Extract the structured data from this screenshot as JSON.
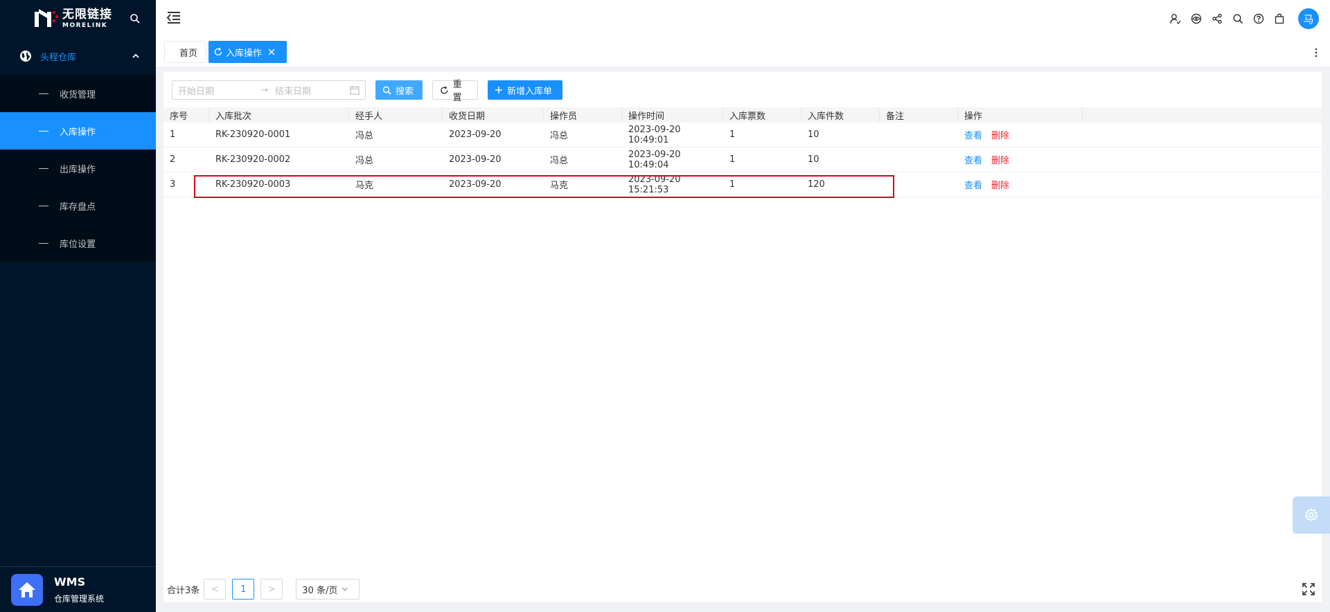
{
  "logo": {
    "cn": "无限链接",
    "en": "MORELINK"
  },
  "sidebar": {
    "group_label": "头程仓库",
    "items": [
      {
        "label": "收货管理",
        "active": false
      },
      {
        "label": "入库操作",
        "active": true
      },
      {
        "label": "出库操作",
        "active": false
      },
      {
        "label": "库存盘点",
        "active": false
      },
      {
        "label": "库位设置",
        "active": false
      }
    ],
    "footer": {
      "title": "WMS",
      "subtitle": "仓库管理系统"
    }
  },
  "header": {
    "avatar_text": "马"
  },
  "tabs": {
    "home": "首页",
    "active": "入库操作"
  },
  "toolbar": {
    "start_placeholder": "开始日期",
    "end_placeholder": "结束日期",
    "range_arrow": "→",
    "search_label": "搜索",
    "reset_label": "重置",
    "add_label": "新增入库单"
  },
  "table": {
    "headers": [
      "序号",
      "入库批次",
      "经手人",
      "收货日期",
      "操作员",
      "操作时间",
      "入库票数",
      "入库件数",
      "备注",
      "操作"
    ],
    "rows": [
      {
        "no": "1",
        "batch": "RK-230920-0001",
        "handler": "冯总",
        "date": "2023-09-20",
        "operator": "冯总",
        "time": "2023-09-20 10:49:01",
        "tickets": "1",
        "pieces": "10",
        "remark": ""
      },
      {
        "no": "2",
        "batch": "RK-230920-0002",
        "handler": "冯总",
        "date": "2023-09-20",
        "operator": "冯总",
        "time": "2023-09-20 10:49:04",
        "tickets": "1",
        "pieces": "10",
        "remark": ""
      },
      {
        "no": "3",
        "batch": "RK-230920-0003",
        "handler": "马克",
        "date": "2023-09-20",
        "operator": "马克",
        "time": "2023-09-20 15:21:53",
        "tickets": "1",
        "pieces": "120",
        "remark": ""
      }
    ],
    "action_view": "查看",
    "action_delete": "删除"
  },
  "pagination": {
    "total": "合计3条",
    "current_page": "1",
    "page_size": "30 条/页",
    "prev": "<",
    "next": ">"
  },
  "colors": {
    "sidebar_bg": "#001529",
    "accent": "#1890ff",
    "danger": "#f5222d",
    "highlight": "#d9001b"
  }
}
